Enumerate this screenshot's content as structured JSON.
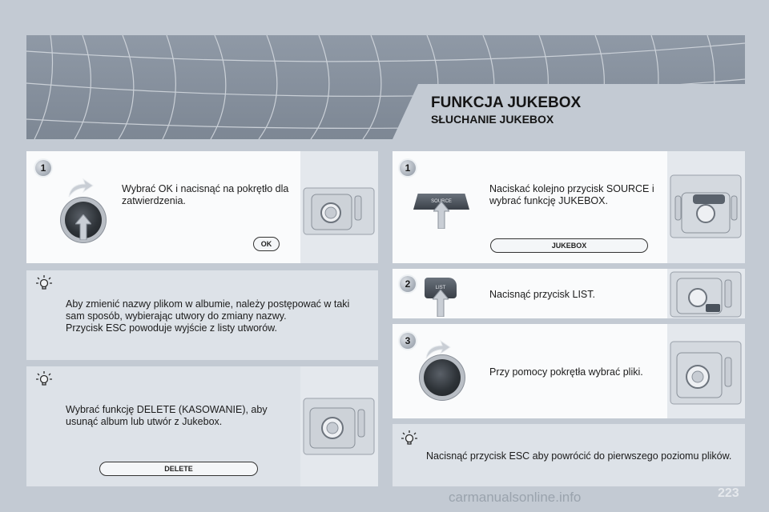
{
  "header": {
    "title": "FUNKCJA JUKEBOX",
    "subtitle": "SŁUCHANIE JUKEBOX"
  },
  "left": {
    "step1": {
      "number": "1",
      "text": "Wybrać OK i nacisnąć na pokrętło dla zatwierdzenia.",
      "pill": "OK"
    },
    "tip1": {
      "text_lines": [
        "Aby zmienić nazwy plikom w albumie, należy postępować w taki",
        "sam sposób, wybierając utwory do zmiany nazwy.",
        "Przycisk ESC powoduje wyjście z listy utworów."
      ]
    },
    "tip2": {
      "text_lines": [
        "Wybrać funkcję DELETE (KASOWANIE), aby",
        "usunąć album lub utwór z Jukebox."
      ],
      "pill": "DELETE"
    }
  },
  "right": {
    "step1": {
      "number": "1",
      "text_lines": [
        "Naciskać kolejno przycisk SOURCE i",
        "wybrać funkcję JUKEBOX."
      ],
      "pill": "JUKEBOX",
      "button_label": "SOURCE"
    },
    "step2": {
      "number": "2",
      "text": "Nacisnąć przycisk LIST.",
      "button_label": "LIST"
    },
    "step3": {
      "number": "3",
      "text": "Przy pomocy pokrętła wybrać pliki."
    },
    "tip": {
      "text": "Nacisnąć przycisk ESC aby powrócić do pierwszego poziomu plików."
    }
  },
  "page_number": "223",
  "watermark": "carmanualsonline.info",
  "colors": {
    "background": "#c3cad3",
    "panel": "#dde2e8",
    "panel_white": "#fafbfc",
    "banner": "#8f99a6"
  }
}
